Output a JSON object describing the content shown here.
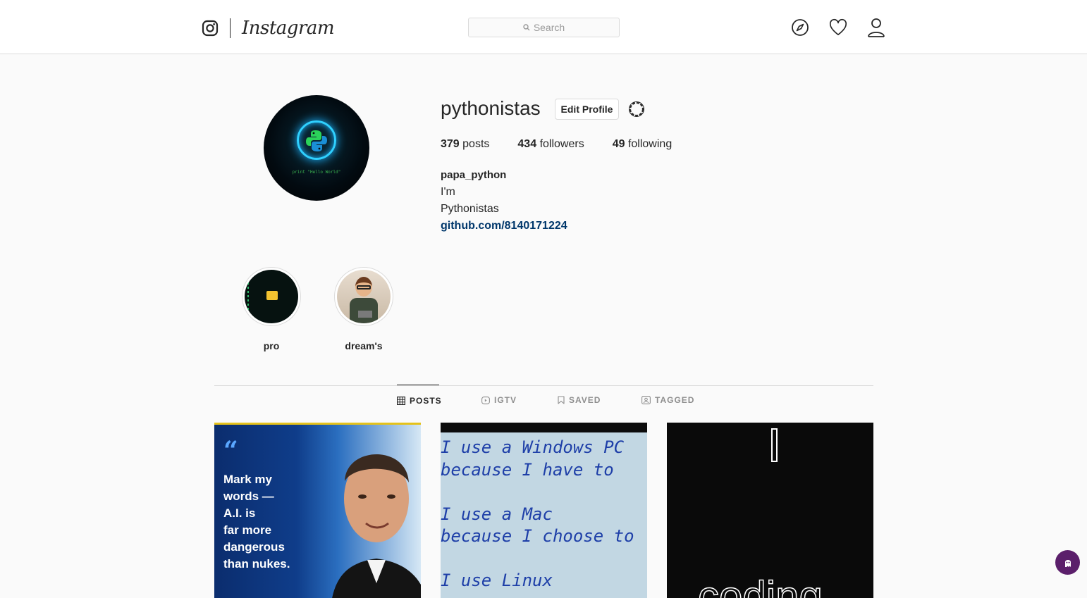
{
  "nav": {
    "logo_icon": "instagram-camera-icon",
    "wordmark": "Instagram",
    "search_placeholder": "Search",
    "icons": [
      "compass-icon",
      "heart-icon",
      "user-icon"
    ]
  },
  "profile": {
    "username": "pythonistas",
    "edit_button": "Edit Profile",
    "settings_icon": "gear-icon",
    "avatar_caption": "print \"Hello World\"",
    "stats": {
      "posts_count": "379",
      "posts_label": "posts",
      "followers_count": "434",
      "followers_label": "followers",
      "following_count": "49",
      "following_label": "following"
    },
    "bio": {
      "full_name": "papa_python",
      "line1": "I'm",
      "line2": "Pythonistas",
      "link": "github.com/8140171224"
    }
  },
  "highlights": [
    {
      "label": "pro"
    },
    {
      "label": "dream's"
    }
  ],
  "tabs": [
    {
      "label": "POSTS",
      "icon": "grid-icon",
      "active": true
    },
    {
      "label": "IGTV",
      "icon": "igtv-icon",
      "active": false
    },
    {
      "label": "SAVED",
      "icon": "bookmark-icon",
      "active": false
    },
    {
      "label": "TAGGED",
      "icon": "tagged-icon",
      "active": false
    }
  ],
  "posts": [
    {
      "quote_mark": "“",
      "text": "Mark my\nwords —\nA.I. is\nfar more\ndangerous\nthan nukes."
    },
    {
      "text": "I use a Windows PC\nbecause I have to\n\nI use a Mac\nbecause I choose to\n\nI use Linux"
    },
    {
      "text": "coding"
    }
  ],
  "colors": {
    "link": "#00376b",
    "border": "#dbdbdb",
    "text": "#262626",
    "muted": "#8e8e8e",
    "fab": "#5b1f6b"
  }
}
